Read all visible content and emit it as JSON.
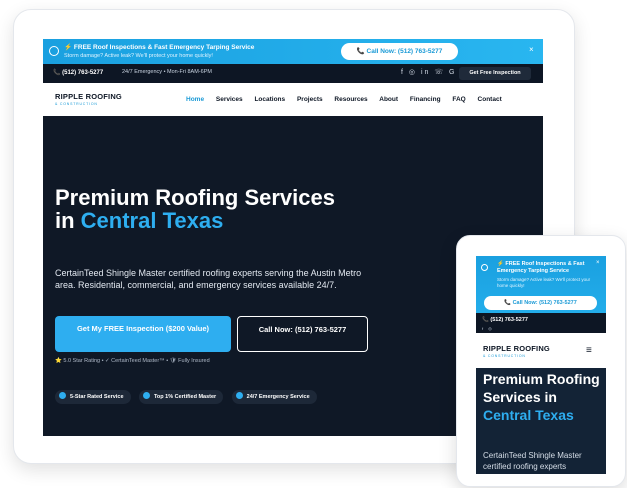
{
  "tablet": {
    "promo": {
      "line1": "⚡ FREE Roof Inspections & Fast Emergency Tarping Service",
      "line2": "Storm damage? Active leak? We'll protect your home quickly!",
      "call_label": "📞 Call Now: (512) 763-5277",
      "close": "×"
    },
    "topbar": {
      "phone": "📞 (512) 763-5277",
      "hours": "24/7 Emergency • Mon-Fri 8AM-6PM",
      "social": "f ◎ in ☏ G",
      "quote_label": "Get Free Inspection"
    },
    "nav": {
      "logo_name": "RIPPLE ROOFING",
      "logo_sub": "& CONSTRUCTION",
      "items": [
        "Home",
        "Services",
        "Locations",
        "Projects",
        "Resources",
        "About",
        "Financing",
        "FAQ",
        "Contact"
      ]
    },
    "hero": {
      "title_part1": "Premium Roofing Services in ",
      "title_highlight": "Central Texas",
      "description": "CertainTeed Shingle Master certified roofing experts serving the Austin Metro area. Residential, commercial, and emergency services available 24/7.",
      "cta_primary": "Get My FREE Inspection ($200 Value)",
      "cta_secondary": "Call Now: (512) 763-5277",
      "rating": "⭐ 5.0 Star Rating • ✓ CertainTeed Master™ • 🛡 Fully Insured",
      "badges": [
        "5-Star Rated Service",
        "Top 1% Certified Master",
        "24/7 Emergency Service"
      ]
    }
  },
  "phone": {
    "promo": {
      "line1": "⚡ FREE Roof Inspections & Fast Emergency Tarping Service",
      "line2": "Storm damage? Active leak? We'll protect your home quickly!",
      "call_label": "📞 Call Now: (512) 763-5277",
      "close": "×"
    },
    "topbar": {
      "phone": "📞 (512) 763-5277",
      "social": "f ◎"
    },
    "nav": {
      "logo_name": "RIPPLE ROOFING",
      "logo_sub": "& CONSTRUCTION",
      "menu_icon": "≡"
    },
    "hero": {
      "title_part1": "Premium Roofing Services in ",
      "title_highlight": "Central Texas",
      "description": "CertainTeed Shingle Master certified roofing experts"
    }
  },
  "colors": {
    "accent": "#2eaef0",
    "dark": "#0d1624",
    "hero_bg": "#0f1826"
  }
}
